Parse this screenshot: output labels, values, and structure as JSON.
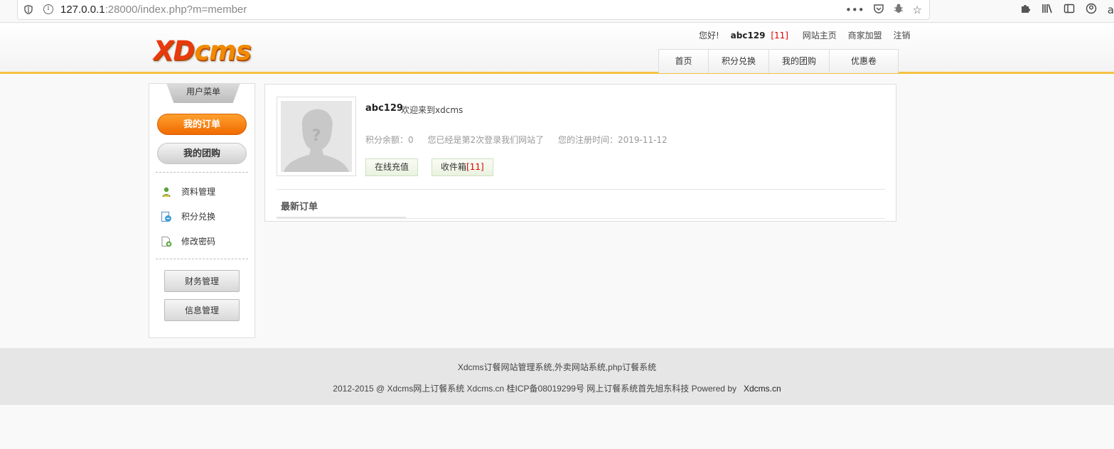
{
  "browser": {
    "url_host": "127.0.0.1",
    "url_rest": ":28000/index.php?m=member"
  },
  "site": {
    "logo": {
      "xd": "XD",
      "cms": "cms"
    },
    "top_links": {
      "greeting": "您好!",
      "username": "abc129",
      "message_count": "[11]",
      "home": "网站主页",
      "merchant": "商家加盟",
      "logout": "注销"
    },
    "nav": [
      "首页",
      "积分兑换",
      "我的团购",
      "优惠卷"
    ]
  },
  "sidebar": {
    "title": "用户菜单",
    "primary_buttons": [
      "我的订单",
      "我的团购"
    ],
    "links": [
      "资料管理",
      "积分兑换",
      "修改密码"
    ],
    "sections": [
      "财务管理",
      "信息管理"
    ]
  },
  "profile": {
    "username": "abc129",
    "welcome": "欢迎来到xdcms",
    "points": "积分余额：0",
    "login_count": "您已经是第2次登录我们网站了",
    "register_time": "您的注册时间：2019-11-12",
    "recharge_button": "在线充值",
    "inbox_button": "收件箱",
    "inbox_count": "[11]"
  },
  "orders": {
    "title": "最新订单"
  },
  "footer": {
    "line1": "Xdcms订餐网站管理系统,外卖网站系统,php订餐系统",
    "line2": "2012-2015 @ Xdcms网上订餐系统 Xdcms.cn 桂ICP备08019299号 网上订餐系统首先旭东科技 Powered by",
    "brand": "Xdcms.cn"
  },
  "colors": {
    "accent_orange": "#f06a00",
    "header_border": "#f5c342",
    "count_red": "#dd0000"
  }
}
